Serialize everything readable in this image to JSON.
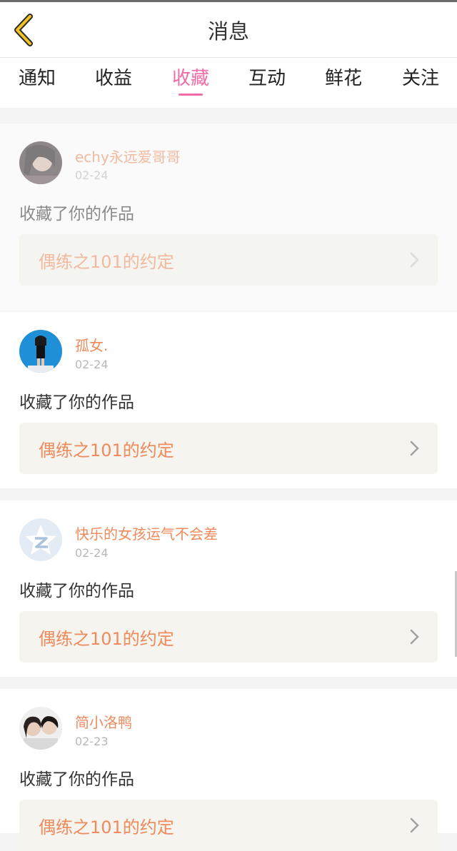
{
  "header": {
    "title": "消息"
  },
  "tabs": [
    {
      "label": "通知"
    },
    {
      "label": "收益"
    },
    {
      "label": "收藏"
    },
    {
      "label": "互动"
    },
    {
      "label": "鲜花"
    },
    {
      "label": "关注"
    }
  ],
  "active_tab": "收藏",
  "colors": {
    "accent": "#f26ba6",
    "username": "#ef8a5c",
    "work_bg": "#f5f4ee"
  },
  "items": [
    {
      "username": "echy永远爱哥哥",
      "date": "02-24",
      "action": "收藏了你的作品",
      "work": "偶练之101的约定",
      "avatar_icon": "user-photo-dark-hair"
    },
    {
      "username": "孤女.",
      "date": "02-24",
      "action": "收藏了你的作品",
      "work": "偶练之101的约定",
      "avatar_icon": "user-photo-blue-background"
    },
    {
      "username": "快乐的女孩运气不会差",
      "date": "02-24",
      "action": "收藏了你的作品",
      "work": "偶练之101的约定",
      "avatar_icon": "qzone-star-icon"
    },
    {
      "username": "简小洛鸭",
      "date": "02-23",
      "action": "收藏了你的作品",
      "work": "偶练之101的约定",
      "avatar_icon": "user-photo-couple"
    }
  ]
}
